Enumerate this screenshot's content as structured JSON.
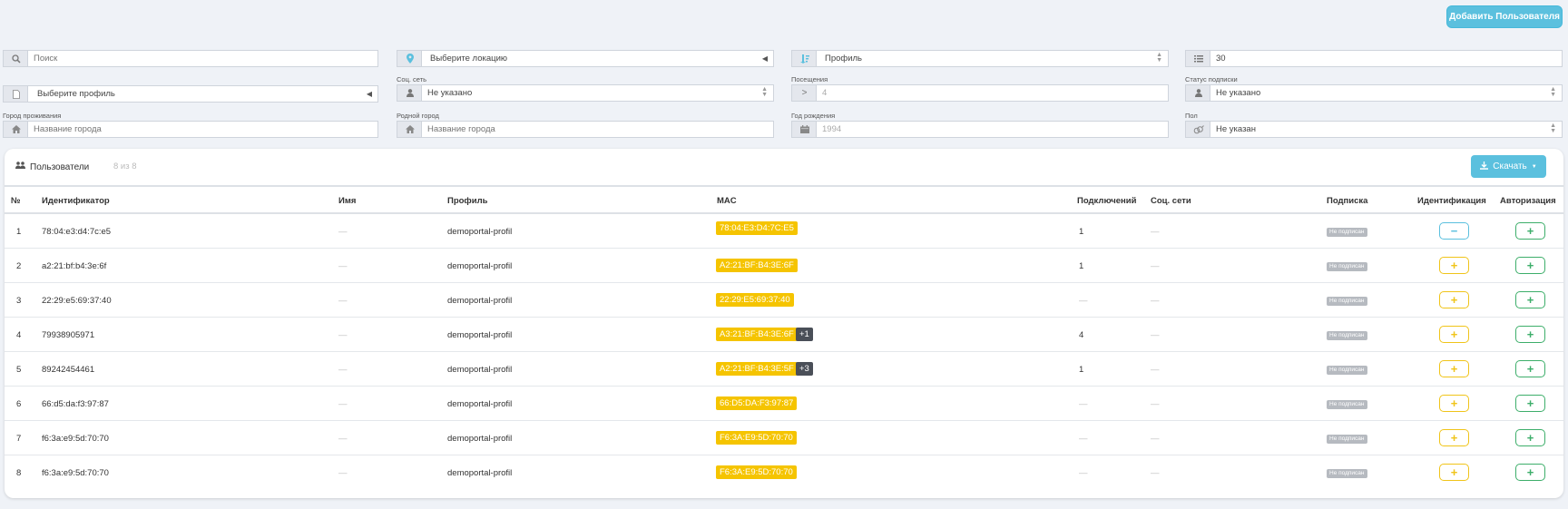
{
  "header": {
    "add_user_label": "Добавить Пользователя"
  },
  "filters": {
    "search": {
      "placeholder": "Поиск",
      "icon": "search-icon"
    },
    "location": {
      "value": "Выберите локацию",
      "icon": "map-marker-icon"
    },
    "sort_profile": {
      "value": "Профиль",
      "icon": "sort-icon"
    },
    "page_size": {
      "value": "30",
      "icon": "list-icon"
    },
    "profile_select": {
      "value": "Выберите профиль",
      "icon": "file-icon"
    },
    "social": {
      "label": "Соц. сеть",
      "value": "Не указано",
      "icon": "user-icon"
    },
    "visits": {
      "label": "Посещения",
      "value": "4",
      "op": ">"
    },
    "subscription_status": {
      "label": "Статус подписки",
      "value": "Не указано",
      "icon": "user-icon"
    },
    "residence_city": {
      "label": "Город проживания",
      "placeholder": "Название города",
      "icon": "home-icon"
    },
    "home_city": {
      "label": "Родной город",
      "placeholder": "Название города",
      "icon": "home-icon"
    },
    "birth_year": {
      "label": "Год рождения",
      "value": "1994",
      "icon": "calendar-icon"
    },
    "gender": {
      "label": "Пол",
      "value": "Не указан",
      "icon": "gender-icon"
    }
  },
  "users_panel": {
    "title": "Пользователи",
    "count": "8 из 8",
    "download_label": "Скачать",
    "columns": [
      "№",
      "Идентификатор",
      "Имя",
      "Профиль",
      "MAC",
      "Подключений",
      "Соц. сети",
      "Подписка",
      "Идентификация",
      "Авторизация"
    ],
    "rows": [
      {
        "num": "1",
        "id": "78:04:e3:d4:7c:e5",
        "name": "—",
        "profile": "demoportal-profil",
        "mac": "78:04:E3:D4:7C:E5",
        "extra": "",
        "connections": "1",
        "social": "—",
        "subscription": "Не подписан",
        "ident": "−",
        "auth": "+"
      },
      {
        "num": "2",
        "id": "a2:21:bf:b4:3e:6f",
        "name": "—",
        "profile": "demoportal-profil",
        "mac": "A2:21:BF:B4:3E:6F",
        "extra": "",
        "connections": "1",
        "social": "—",
        "subscription": "Не подписан",
        "ident": "+",
        "auth": "+"
      },
      {
        "num": "3",
        "id": "22:29:e5:69:37:40",
        "name": "—",
        "profile": "demoportal-profil",
        "mac": "22:29:E5:69:37:40",
        "extra": "",
        "connections": "—",
        "social": "—",
        "subscription": "Не подписан",
        "ident": "+",
        "auth": "+"
      },
      {
        "num": "4",
        "id": "79938905971",
        "name": "—",
        "profile": "demoportal-profil",
        "mac": "A3:21:BF:B4:3E:6F",
        "extra": "+1",
        "connections": "4",
        "social": "—",
        "subscription": "Не подписан",
        "ident": "+",
        "auth": "+"
      },
      {
        "num": "5",
        "id": "89242454461",
        "name": "—",
        "profile": "demoportal-profil",
        "mac": "A2:21:BF:B4:3E:5F",
        "extra": "+3",
        "connections": "1",
        "social": "—",
        "subscription": "Не подписан",
        "ident": "+",
        "auth": "+"
      },
      {
        "num": "6",
        "id": "66:d5:da:f3:97:87",
        "name": "—",
        "profile": "demoportal-profil",
        "mac": "66:D5:DA:F3:97:87",
        "extra": "",
        "connections": "—",
        "social": "—",
        "subscription": "Не подписан",
        "ident": "+",
        "auth": "+"
      },
      {
        "num": "7",
        "id": "f6:3a:e9:5d:70:70",
        "name": "—",
        "profile": "demoportal-profil",
        "mac": "F6:3A:E9:5D:70:70",
        "extra": "",
        "connections": "—",
        "social": "—",
        "subscription": "Не подписан",
        "ident": "+",
        "auth": "+"
      },
      {
        "num": "8",
        "id": "f6:3a:e9:5d:70:70",
        "name": "—",
        "profile": "demoportal-profil",
        "mac": "F6:3A:E9:5D:70:70",
        "extra": "",
        "connections": "—",
        "social": "—",
        "subscription": "Не подписан",
        "ident": "+",
        "auth": "+"
      }
    ]
  },
  "colors": {
    "accent": "#5bc0de",
    "mac_badge": "#f5c400",
    "auth_green": "#3dae6a"
  }
}
